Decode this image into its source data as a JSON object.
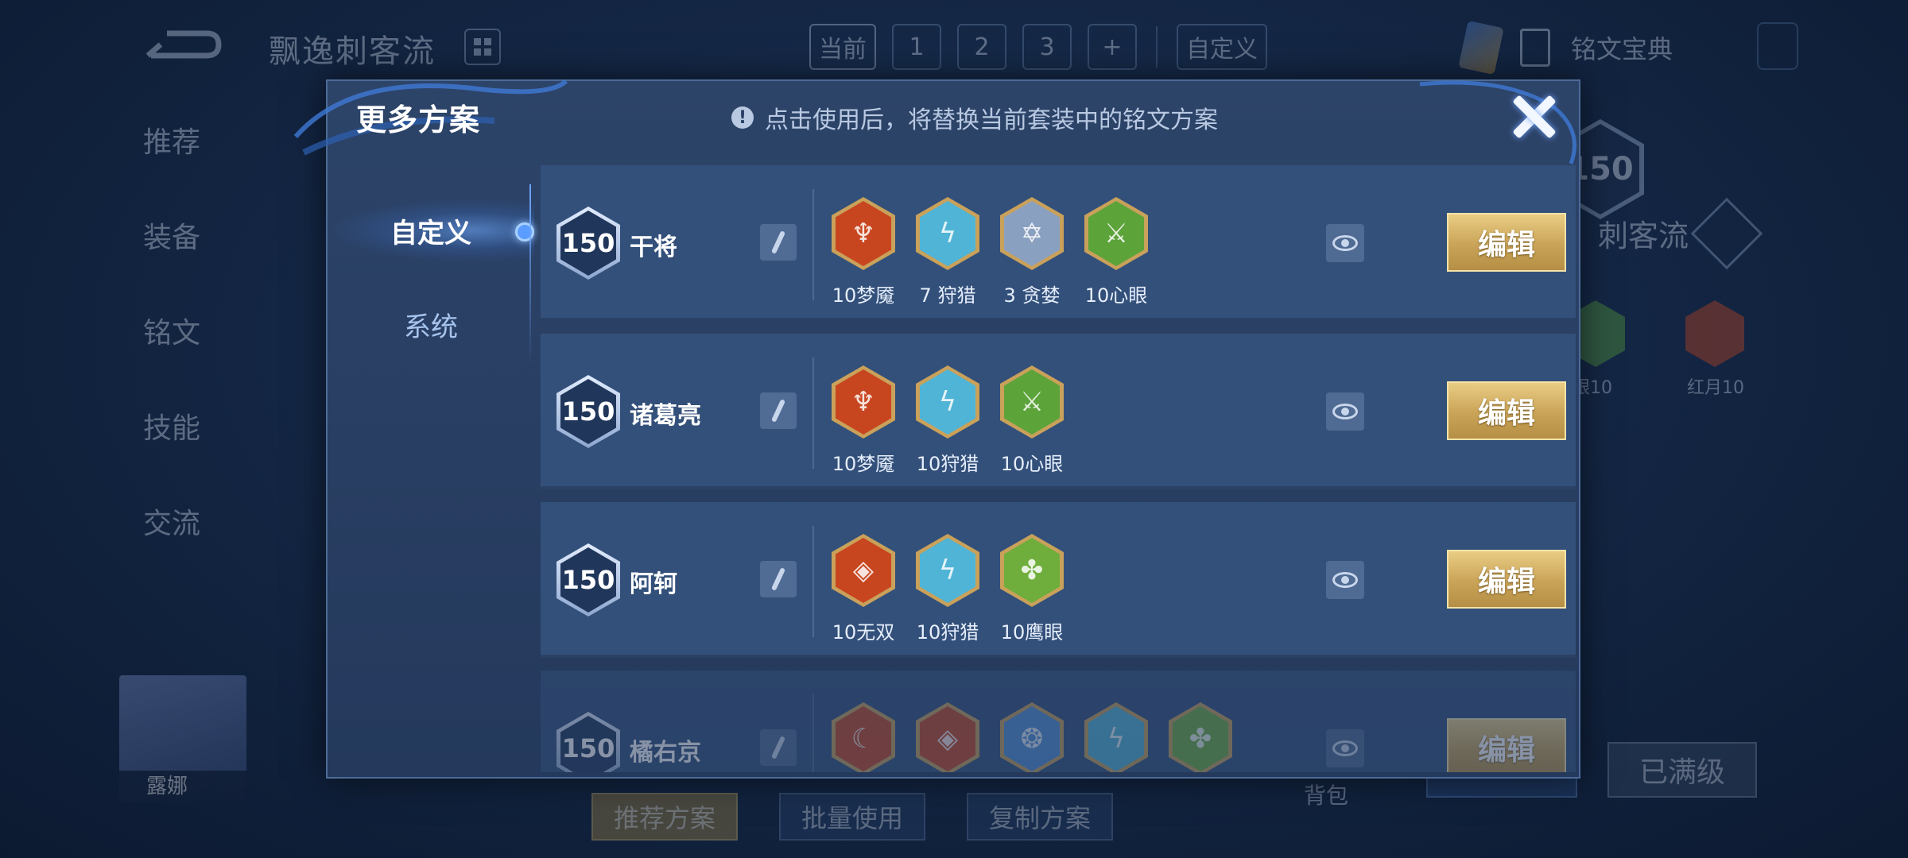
{
  "background": {
    "title": "飘逸刺客流",
    "tabs": [
      "当前",
      "1",
      "2",
      "3",
      "+",
      "自定义"
    ],
    "rune_tome": "铭文宝典",
    "side_nav": [
      "推荐",
      "装备",
      "铭文",
      "技能",
      "交流"
    ],
    "hero_name": "露娜",
    "level": "150",
    "build_name": "刺客流",
    "rune_labels": [
      "眼10",
      "红月10"
    ],
    "bag": "背包",
    "maxed": "已满级",
    "bottom_buttons": [
      "推荐方案",
      "批量使用",
      "复制方案"
    ],
    "colors": {
      "accent_gold": "#c9a357",
      "panel": "#33507a"
    }
  },
  "modal": {
    "title": "更多方案",
    "notice": "点击使用后，将替换当前套装中的铭文方案",
    "notice_icon": "!",
    "tabs": {
      "custom": "自定义",
      "system": "系统"
    },
    "edit_label": "编辑",
    "rows": [
      {
        "level": "150",
        "name": "干将",
        "runes": [
          {
            "label": "10梦魇",
            "color": "#c8461f",
            "glyph": "♆"
          },
          {
            "label": "7 狩猎",
            "color": "#4fb4d6",
            "glyph": "ϟ"
          },
          {
            "label": "3 贪婪",
            "color": "#8aa0c0",
            "glyph": "✡"
          },
          {
            "label": "10心眼",
            "color": "#5ca33a",
            "glyph": "⚔"
          }
        ]
      },
      {
        "level": "150",
        "name": "诸葛亮",
        "runes": [
          {
            "label": "10梦魇",
            "color": "#c8461f",
            "glyph": "♆"
          },
          {
            "label": "10狩猎",
            "color": "#4fb4d6",
            "glyph": "ϟ"
          },
          {
            "label": "10心眼",
            "color": "#5ca33a",
            "glyph": "⚔"
          }
        ]
      },
      {
        "level": "150",
        "name": "阿轲",
        "runes": [
          {
            "label": "10无双",
            "color": "#c8461f",
            "glyph": "◈"
          },
          {
            "label": "10狩猎",
            "color": "#4fb4d6",
            "glyph": "ϟ"
          },
          {
            "label": "10鹰眼",
            "color": "#6fae3c",
            "glyph": "✤"
          }
        ]
      },
      {
        "level": "150",
        "name": "橘右京",
        "runes": [
          {
            "label": "",
            "color": "#c8461f",
            "glyph": "☾"
          },
          {
            "label": "",
            "color": "#c8461f",
            "glyph": "◈"
          },
          {
            "label": "",
            "color": "#4f8fd6",
            "glyph": "❂"
          },
          {
            "label": "",
            "color": "#4fb4d6",
            "glyph": "ϟ"
          },
          {
            "label": "",
            "color": "#6fae3c",
            "glyph": "✤"
          }
        ]
      }
    ]
  }
}
